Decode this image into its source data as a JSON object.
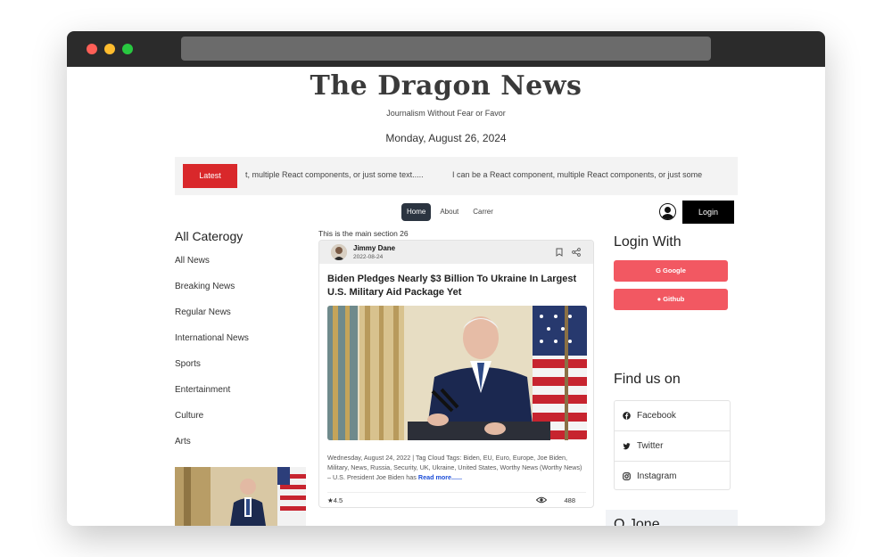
{
  "browser": {
    "dots": [
      "#ff5f57",
      "#febc2e",
      "#28c840"
    ]
  },
  "header": {
    "brand": "The Dragon News",
    "tagline": "Journalism Without Fear or Favor",
    "date": "Monday, August 26, 2024"
  },
  "ticker": {
    "badge": "Latest",
    "text1": "t, multiple React components, or just some text.....",
    "text2": "I can be a React component, multiple React components, or just some"
  },
  "nav": {
    "items": [
      "Home",
      "About",
      "Carrer"
    ],
    "active": "Home",
    "login": "Login"
  },
  "sidebar": {
    "title": "All Caterogy",
    "items": [
      "All News",
      "Breaking News",
      "Regular News",
      "International News",
      "Sports",
      "Entertainment",
      "Culture",
      "Arts"
    ]
  },
  "main": {
    "note": "This is the main section 26",
    "card": {
      "author": "Jimmy Dane",
      "date": "2022-08-24",
      "title": "Biden Pledges Nearly $3 Billion To Ukraine In Largest U.S. Military Aid Package Yet",
      "excerpt": "Wednesday, August 24, 2022 | Tag Cloud Tags: Biden, EU, Euro, Europe, Joe Biden, Military, News, Russia, Security, UK, Ukraine, United States, Worthy News (Worthy News) – U.S. President Joe Biden has",
      "read_more": "Read more......",
      "rating": "4.5",
      "views": "488"
    }
  },
  "right": {
    "login_with": "Login With",
    "google": "Google",
    "github": "Github",
    "find_us": "Find us on",
    "social": [
      "Facebook",
      "Twitter",
      "Instagram"
    ],
    "qzone": "Q Jone"
  },
  "colors": {
    "accent_red": "#d9282b",
    "button_red": "#f25862",
    "dark": "#2b3440"
  }
}
